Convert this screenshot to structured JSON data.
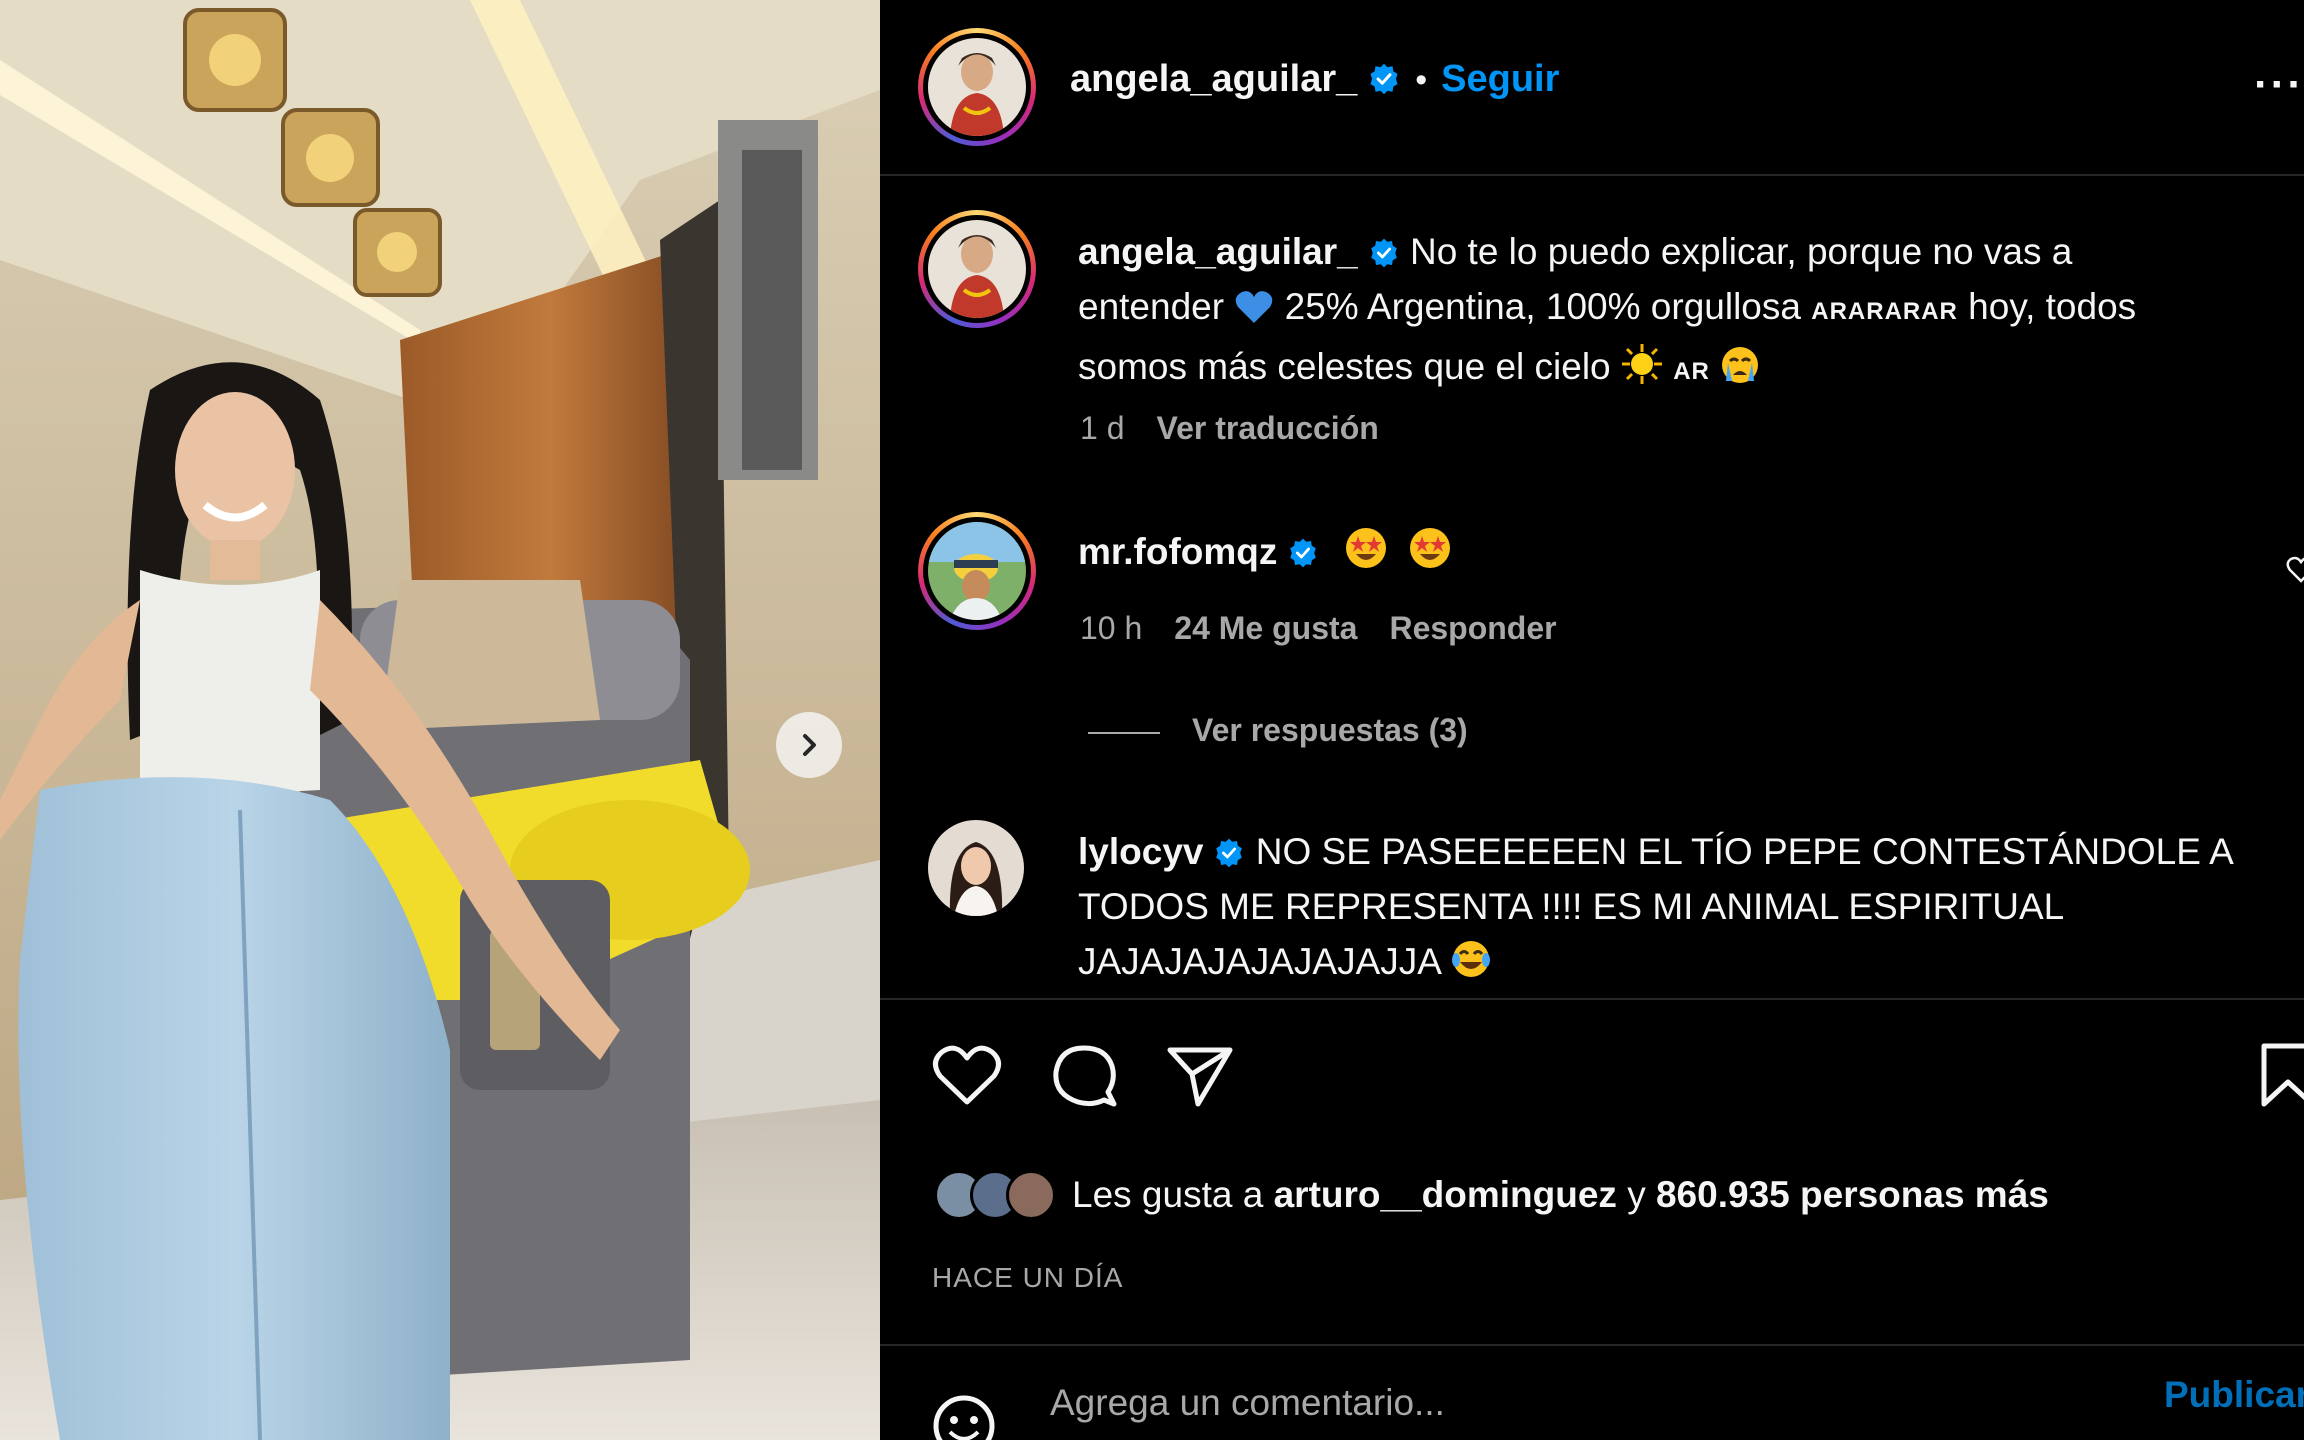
{
  "header": {
    "username": "angela_aguilar_",
    "separator": "•",
    "follow_label": "Seguir",
    "more_label": "···"
  },
  "caption": {
    "username": "angela_aguilar_",
    "line1": "No te lo puedo explicar, porque no vas a",
    "line2a": "entender",
    "line2b": "25% Argentina, 100% orgullosa",
    "line2c": "ARARARAR",
    "line2d": "hoy, todos",
    "line3a": "somos más celestes que el cielo",
    "line3b": "AR",
    "time": "1 d",
    "translate_label": "Ver traducción"
  },
  "comments": [
    {
      "username": "mr.fofomqz",
      "time": "10 h",
      "likes": "24 Me gusta",
      "reply_label": "Responder",
      "view_replies": "Ver respuestas (3)"
    },
    {
      "username": "lylocyv",
      "line1": "NO SE PASEEEEEEN EL TÍO PEPE CONTESTÁNDOLE A",
      "line2": "TODOS ME REPRESENTA !!!! ES MI ANIMAL ESPIRITUAL",
      "line3": "JAJAJAJAJAJAJAJJA"
    }
  ],
  "likes": {
    "prefix": "Les gusta a",
    "user": "arturo__dominguez",
    "connector": "y",
    "count_text": "860.935 personas más"
  },
  "time_ago": "HACE UN DÍA",
  "composer": {
    "placeholder": "Agrega un comentario...",
    "publish_label": "Publicar"
  },
  "icons": [
    "chevron-right-icon",
    "verified-badge-icon",
    "heart-icon",
    "comment-icon",
    "share-icon",
    "bookmark-icon",
    "emoji-icon"
  ],
  "colors": {
    "link": "#0095f6",
    "verified": "#0095f6",
    "muted": "#a8a8a8",
    "background": "#000000"
  }
}
